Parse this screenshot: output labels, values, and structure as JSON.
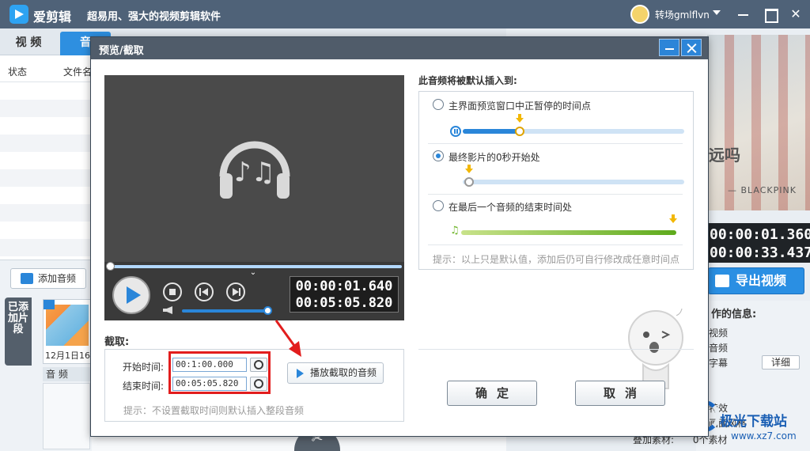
{
  "app": {
    "name": "爱剪辑",
    "slogan": "超易用、强大的视频剪辑软件",
    "user_name": "转场gmlflvn"
  },
  "main_tabs": [
    {
      "label": "视 频"
    },
    {
      "label": "音"
    }
  ],
  "audio_list": {
    "col_status": "状态",
    "col_file": "文件名"
  },
  "left_panel": {
    "add_audio_label": "添加音频",
    "added_clips_tab": "已添加片段",
    "clip_date": "12月1日16",
    "audio_track_label": "音 频"
  },
  "right_panel": {
    "preview_caption": "远吗",
    "preview_artist": "— BLACKPINK",
    "time_current": "00:00:01.360",
    "time_total": "00:00:33.437",
    "export_label": "导出视频",
    "info_title": "作的信息:",
    "info_items": [
      "视频",
      "音频",
      "字幕",
      "特效",
      "画面风格"
    ],
    "detail_label": "详细",
    "overlay_label": "叠加素材:",
    "overlay_count": "0个素材"
  },
  "watermark": {
    "title": "极光下载站",
    "url": "www.xz7.com"
  },
  "dialog": {
    "title": "预览/截取",
    "player": {
      "time_current": "00:00:01.640",
      "time_total": "00:05:05.820",
      "seek_progress": 0.0,
      "volume": 1.0
    },
    "crop": {
      "section_label": "截取:",
      "start_label": "开始时间:",
      "end_label": "结束时间:",
      "start_value": "00:1:00.000",
      "end_value": "00:05:05.820",
      "play_crop_label": "播放截取的音频",
      "hint": "提示：不设置截取时间则默认插入整段音频"
    },
    "insert": {
      "title": "此音频将被默认插入到:",
      "options": [
        {
          "label": "主界面预览窗口中正暂停的时间点",
          "checked": false
        },
        {
          "label": "最终影片的0秒开始处",
          "checked": true
        },
        {
          "label": "在最后一个音频的结束时间处",
          "checked": false
        }
      ],
      "hint": "提示：以上只是默认值，添加后仍可自行修改成任意时间点"
    },
    "ok_label": "确定",
    "cancel_label": "取消"
  },
  "colors": {
    "accent": "#2a86d9",
    "title_bar": "#4f6278",
    "highlight": "#e21d1d",
    "marker": "#f2b705"
  }
}
